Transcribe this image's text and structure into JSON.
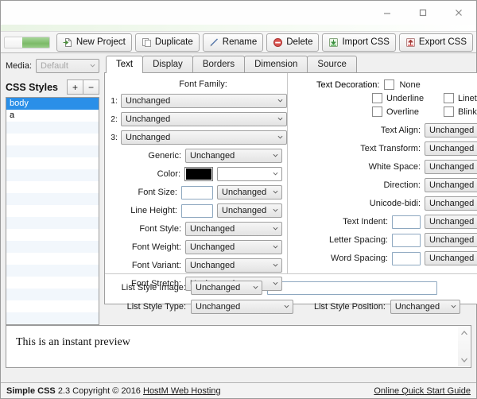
{
  "window": {
    "controls": [
      {
        "name": "minimize-button",
        "glyph": "minimize"
      },
      {
        "name": "maximize-button",
        "glyph": "maximize"
      },
      {
        "name": "close-button",
        "glyph": "close"
      }
    ]
  },
  "toolbar": {
    "progress_value": 60,
    "buttons": [
      {
        "label": "New Project",
        "icon": "new-project-icon"
      },
      {
        "label": "Duplicate",
        "icon": "duplicate-icon"
      },
      {
        "label": "Rename",
        "icon": "rename-icon"
      },
      {
        "label": "Delete",
        "icon": "delete-icon"
      },
      {
        "label": "Import CSS",
        "icon": "import-icon"
      },
      {
        "label": "Export CSS",
        "icon": "export-icon"
      }
    ]
  },
  "sidebar": {
    "media_label": "Media:",
    "media_value": "Default",
    "styles_title": "CSS Styles",
    "add_label": "+",
    "remove_label": "−",
    "styles": [
      "body",
      "a"
    ],
    "selected_style": "body"
  },
  "tabs": [
    {
      "label": "Text",
      "active": true
    },
    {
      "label": "Display",
      "active": false
    },
    {
      "label": "Borders",
      "active": false
    },
    {
      "label": "Dimension",
      "active": false
    },
    {
      "label": "Source",
      "active": false
    }
  ],
  "text_panel": {
    "font_family_title": "Font Family:",
    "font_family": [
      {
        "num": "1:",
        "value": "Unchanged"
      },
      {
        "num": "2:",
        "value": "Unchanged"
      },
      {
        "num": "3:",
        "value": "Unchanged"
      }
    ],
    "generic_label": "Generic:",
    "generic_value": "Unchanged",
    "color_label": "Color:",
    "color_swatch": "#000000",
    "color_value": "",
    "font_size_label": "Font Size:",
    "font_size_value": "",
    "font_size_unit": "Unchanged",
    "line_height_label": "Line Height:",
    "line_height_value": "",
    "line_height_unit": "Unchanged",
    "font_style_label": "Font Style:",
    "font_style_value": "Unchanged",
    "font_weight_label": "Font Weight:",
    "font_weight_value": "Unchanged",
    "font_variant_label": "Font Variant:",
    "font_variant_value": "Unchanged",
    "font_stretch_label": "Font Stretch:",
    "font_stretch_value": "Unchanged",
    "text_decoration_label": "Text Decoration:",
    "decorations": [
      {
        "label": "None",
        "checked": false
      },
      {
        "label": "Underline",
        "checked": false
      },
      {
        "label": "Linethrough",
        "checked": false
      },
      {
        "label": "Overline",
        "checked": false
      },
      {
        "label": "Blink",
        "checked": false
      }
    ],
    "text_align_label": "Text Align:",
    "text_align_value": "Unchanged",
    "text_transform_label": "Text Transform:",
    "text_transform_value": "Unchanged",
    "white_space_label": "White Space:",
    "white_space_value": "Unchanged",
    "direction_label": "Direction:",
    "direction_value": "Unchanged",
    "unicode_bidi_label": "Unicode-bidi:",
    "unicode_bidi_value": "Unchanged",
    "text_indent_label": "Text Indent:",
    "text_indent_value": "",
    "text_indent_unit": "Unchanged",
    "letter_spacing_label": "Letter Spacing:",
    "letter_spacing_value": "",
    "letter_spacing_unit": "Unchanged",
    "word_spacing_label": "Word Spacing:",
    "word_spacing_value": "",
    "word_spacing_unit": "Unchanged",
    "list_style_image_label": "List Style Image:",
    "list_style_image_value": "Unchanged",
    "list_style_image_url": "",
    "list_style_type_label": "List Style Type:",
    "list_style_type_value": "Unchanged",
    "list_style_position_label": "List Style Position:",
    "list_style_position_value": "Unchanged"
  },
  "preview": {
    "text": "This is an instant preview"
  },
  "status": {
    "app_name": "Simple CSS",
    "version_copyright": "2.3 Copyright © 2016",
    "vendor": "HostM Web Hosting",
    "guide_link": "Online Quick Start Guide"
  },
  "colors": {
    "selection_blue": "#2a8fe8",
    "progress_green": "#7cba68",
    "import_green": "#4caf50",
    "export_red": "#d9534f"
  }
}
